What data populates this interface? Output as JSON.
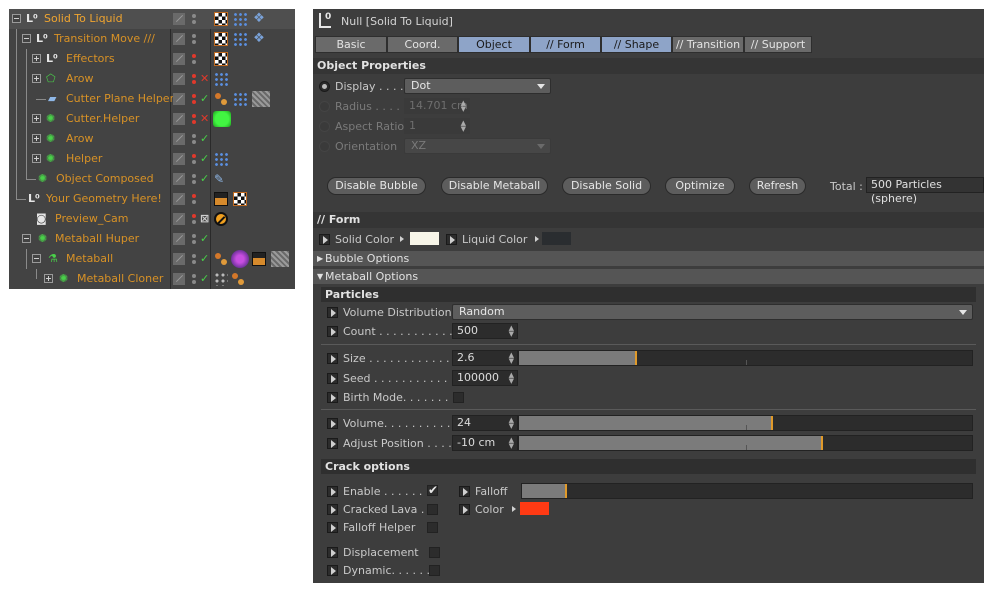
{
  "object_manager": {
    "rows": [
      {
        "name": "Solid To Liquid"
      },
      {
        "name": "Transition Move ///"
      },
      {
        "name": "Effectors"
      },
      {
        "name": "Arow"
      },
      {
        "name": "Cutter Plane Helper"
      },
      {
        "name": "Cutter.Helper"
      },
      {
        "name": "Arow"
      },
      {
        "name": "Helper"
      },
      {
        "name": "Object Composed"
      },
      {
        "name": "Your Geometry Here!"
      },
      {
        "name": "Preview_Cam"
      },
      {
        "name": "Metaball Huper"
      },
      {
        "name": "Metaball"
      },
      {
        "name": "Metaball Cloner"
      }
    ]
  },
  "attribute_manager": {
    "title": "Null [Solid To Liquid]",
    "tabs": [
      {
        "label": "Basic"
      },
      {
        "label": "Coord."
      },
      {
        "label": "Object"
      },
      {
        "label": "// Form"
      },
      {
        "label": "// Shape"
      },
      {
        "label": "// Transition"
      },
      {
        "label": "// Support"
      }
    ],
    "object_properties": {
      "heading": "Object Properties",
      "display_label": "Display . . . .",
      "display_value": "Dot",
      "radius_label": "Radius . . . . .",
      "radius_value": "14.701 cm",
      "aspect_label": "Aspect Ratio",
      "aspect_value": "1",
      "orientation_label": "Orientation",
      "orientation_value": "XZ"
    },
    "buttons": {
      "disable_bubble": "Disable Bubble",
      "disable_metaball": "Disable Metaball",
      "disable_solid": "Disable Solid",
      "optimize": "Optimize",
      "refresh": "Refresh",
      "total_label": "Total :",
      "total_value": "500 Particles (sphere)"
    },
    "form": {
      "heading": "// Form",
      "solid_color_label": "Solid Color",
      "liquid_color_label": "Liquid Color",
      "solid_color": "#f7f5e8",
      "liquid_color": "#2a2d30",
      "bubble_options": "Bubble Options",
      "metaball_options": "Metaball Options"
    },
    "particles": {
      "heading": "Particles",
      "volume_distribution_label": "Volume Distribution",
      "volume_distribution_value": "Random",
      "count_label": "Count . . . . . . . . . . . .",
      "count_value": "500",
      "size_label": "Size . . . . . . . . . . . . . .",
      "size_value": "2.6",
      "size_fraction": 0.26,
      "seed_label": "Seed . . . . . . . . . . . . .",
      "seed_value": "100000",
      "birth_mode_label": "Birth Mode. . . . . . . .",
      "volume_label": "Volume. . . . . . . . . . .",
      "volume_value": "24",
      "volume_fraction": 0.56,
      "adjust_position_label": "Adjust Position . . . .",
      "adjust_position_value": "-10 cm",
      "adjust_position_fraction": 0.67
    },
    "crack": {
      "heading": "Crack options",
      "enable_label": "Enable . . . . . . .",
      "enable_checked": "✔",
      "cracked_lava_label": "Cracked Lava . .",
      "falloff_helper_label": "Falloff Helper",
      "displacement_label": "Displacement",
      "dynamic_label": "Dynamic. . . . . . .",
      "falloff_label": "Falloff",
      "falloff_fraction": 0.1,
      "color_label": "Color",
      "color_value": "#ff3a14"
    }
  }
}
